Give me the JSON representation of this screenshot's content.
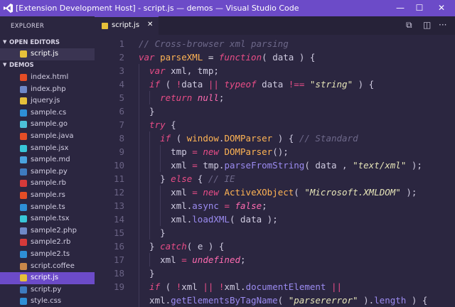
{
  "window": {
    "title": "[Extension Development Host] - script.js — demos — Visual Studio Code",
    "controls": {
      "minimize": "—",
      "maximize": "☐",
      "close": "✕"
    }
  },
  "sidebar": {
    "title": "EXPLORER",
    "open_editors_label": "OPEN EDITORS",
    "open_editors": [
      {
        "name": "script.js",
        "icon": "js-icon",
        "color": "#e6c03a"
      }
    ],
    "folder_label": "DEMOS",
    "files": [
      {
        "name": "index.html",
        "icon": "html5-icon",
        "color": "#e44d26",
        "glyph": "5"
      },
      {
        "name": "index.php",
        "icon": "php-icon",
        "color": "#6f89c8",
        "glyph": "php"
      },
      {
        "name": "jquery.js",
        "icon": "js-icon",
        "color": "#e6c03a",
        "glyph": "JS"
      },
      {
        "name": "sample.cs",
        "icon": "csharp-icon",
        "color": "#2e8fd6",
        "glyph": "C#"
      },
      {
        "name": "sample.go",
        "icon": "go-icon",
        "color": "#4cc0d9",
        "glyph": "go"
      },
      {
        "name": "sample.java",
        "icon": "java-icon",
        "color": "#e44d26",
        "glyph": "J"
      },
      {
        "name": "sample.jsx",
        "icon": "react-icon",
        "color": "#38c6d8",
        "glyph": "⚛"
      },
      {
        "name": "sample.md",
        "icon": "markdown-icon",
        "color": "#4aa3df",
        "glyph": "M"
      },
      {
        "name": "sample.py",
        "icon": "python-icon",
        "color": "#3e7bbf",
        "glyph": "py"
      },
      {
        "name": "sample.rb",
        "icon": "ruby-icon",
        "color": "#d63a3a",
        "glyph": "◆"
      },
      {
        "name": "sample.rs",
        "icon": "rust-icon",
        "color": "#e44d26",
        "glyph": "R"
      },
      {
        "name": "sample.ts",
        "icon": "typescript-icon",
        "color": "#2e8fd6",
        "glyph": "TS"
      },
      {
        "name": "sample.tsx",
        "icon": "react-icon",
        "color": "#38c6d8",
        "glyph": "⚛"
      },
      {
        "name": "sample2.php",
        "icon": "php-icon",
        "color": "#6f89c8",
        "glyph": "php"
      },
      {
        "name": "sample2.rb",
        "icon": "ruby-icon",
        "color": "#d63a3a",
        "glyph": "◆"
      },
      {
        "name": "sample2.ts",
        "icon": "typescript-icon",
        "color": "#2e8fd6",
        "glyph": "TS"
      },
      {
        "name": "script.coffee",
        "icon": "coffee-icon",
        "color": "#c9874a",
        "glyph": "☕"
      },
      {
        "name": "script.js",
        "icon": "js-icon",
        "color": "#e6c03a",
        "glyph": "JS",
        "selected": true
      },
      {
        "name": "script.py",
        "icon": "python-icon",
        "color": "#3e7bbf",
        "glyph": "py"
      },
      {
        "name": "style.css",
        "icon": "css3-icon",
        "color": "#2e8fd6",
        "glyph": "3"
      }
    ]
  },
  "editor": {
    "active_tab": "script.js",
    "close_glyph": "✕",
    "actions": {
      "split_glyph": "⧉",
      "layout_glyph": "◫",
      "more_glyph": "···"
    },
    "lines": [
      {
        "n": "1",
        "indent": 0,
        "tokens": [
          [
            "c",
            "// Cross-browser xml parsing"
          ]
        ]
      },
      {
        "n": "2",
        "indent": 0,
        "tokens": [
          [
            "k",
            "var "
          ],
          [
            "f",
            "parseXML"
          ],
          [
            "p",
            " = "
          ],
          [
            "k",
            "function"
          ],
          [
            "u",
            "( "
          ],
          [
            "v",
            "data"
          ],
          [
            "u",
            " ) {"
          ]
        ]
      },
      {
        "n": "3",
        "indent": 1,
        "tokens": [
          [
            "k",
            "var "
          ],
          [
            "v",
            "xml, tmp;"
          ]
        ]
      },
      {
        "n": "4",
        "indent": 1,
        "tokens": [
          [
            "k",
            "if"
          ],
          [
            "u",
            " ( "
          ],
          [
            "o",
            "!"
          ],
          [
            "v",
            "data "
          ],
          [
            "o",
            "||"
          ],
          [
            "k",
            " typeof "
          ],
          [
            "v",
            "data "
          ],
          [
            "o",
            "!=="
          ],
          [
            "u",
            " "
          ],
          [
            "s",
            "\"string\""
          ],
          [
            "u",
            " ) {"
          ]
        ]
      },
      {
        "n": "5",
        "indent": 2,
        "tokens": [
          [
            "k",
            "return "
          ],
          [
            "b",
            "null"
          ],
          [
            "u",
            ";"
          ]
        ]
      },
      {
        "n": "6",
        "indent": 1,
        "tokens": [
          [
            "u",
            "}"
          ]
        ]
      },
      {
        "n": "7",
        "indent": 1,
        "tokens": [
          [
            "k",
            "try"
          ],
          [
            "u",
            " {"
          ]
        ]
      },
      {
        "n": "8",
        "indent": 2,
        "tokens": [
          [
            "k",
            "if"
          ],
          [
            "u",
            " ( "
          ],
          [
            "i",
            "window"
          ],
          [
            "u",
            "."
          ],
          [
            "i",
            "DOMParser"
          ],
          [
            "u",
            " ) { "
          ],
          [
            "c",
            "// Standard"
          ]
        ]
      },
      {
        "n": "9",
        "indent": 3,
        "tokens": [
          [
            "v",
            "tmp "
          ],
          [
            "o",
            "="
          ],
          [
            "k",
            " new "
          ],
          [
            "i",
            "DOMParser"
          ],
          [
            "u",
            "();"
          ]
        ]
      },
      {
        "n": "10",
        "indent": 3,
        "tokens": [
          [
            "v",
            "xml "
          ],
          [
            "o",
            "="
          ],
          [
            "v",
            " tmp."
          ],
          [
            "r",
            "parseFromString"
          ],
          [
            "u",
            "( "
          ],
          [
            "v",
            "data"
          ],
          [
            "u",
            " , "
          ],
          [
            "s",
            "\"text/xml\""
          ],
          [
            "u",
            " );"
          ]
        ]
      },
      {
        "n": "11",
        "indent": 2,
        "tokens": [
          [
            "u",
            "} "
          ],
          [
            "k",
            "else"
          ],
          [
            "u",
            " { "
          ],
          [
            "c",
            "// IE"
          ]
        ]
      },
      {
        "n": "12",
        "indent": 3,
        "tokens": [
          [
            "v",
            "xml "
          ],
          [
            "o",
            "="
          ],
          [
            "k",
            " new "
          ],
          [
            "i",
            "ActiveXObject"
          ],
          [
            "u",
            "( "
          ],
          [
            "s",
            "\"Microsoft.XMLDOM\""
          ],
          [
            "u",
            " );"
          ]
        ]
      },
      {
        "n": "13",
        "indent": 3,
        "tokens": [
          [
            "v",
            "xml."
          ],
          [
            "r",
            "async"
          ],
          [
            "o",
            " = "
          ],
          [
            "b",
            "false"
          ],
          [
            "u",
            ";"
          ]
        ]
      },
      {
        "n": "14",
        "indent": 3,
        "tokens": [
          [
            "v",
            "xml."
          ],
          [
            "r",
            "loadXML"
          ],
          [
            "u",
            "( "
          ],
          [
            "v",
            "data"
          ],
          [
            "u",
            " );"
          ]
        ]
      },
      {
        "n": "15",
        "indent": 2,
        "tokens": [
          [
            "u",
            "}"
          ]
        ]
      },
      {
        "n": "16",
        "indent": 1,
        "tokens": [
          [
            "u",
            "} "
          ],
          [
            "k",
            "catch"
          ],
          [
            "u",
            "( "
          ],
          [
            "v",
            "e"
          ],
          [
            "u",
            " ) {"
          ]
        ]
      },
      {
        "n": "17",
        "indent": 2,
        "tokens": [
          [
            "v",
            "xml "
          ],
          [
            "o",
            "="
          ],
          [
            "b",
            " undefined"
          ],
          [
            "u",
            ";"
          ]
        ]
      },
      {
        "n": "18",
        "indent": 1,
        "tokens": [
          [
            "u",
            "}"
          ]
        ]
      },
      {
        "n": "19",
        "indent": 1,
        "tokens": [
          [
            "k",
            "if"
          ],
          [
            "u",
            " ( "
          ],
          [
            "o",
            "!"
          ],
          [
            "v",
            "xml "
          ],
          [
            "o",
            "||"
          ],
          [
            "o",
            " !"
          ],
          [
            "v",
            "xml."
          ],
          [
            "r",
            "documentElement"
          ],
          [
            "o",
            " ||"
          ]
        ]
      },
      {
        "n": "",
        "indent": 1,
        "tokens": [
          [
            "v",
            "xml."
          ],
          [
            "r",
            "getElementsByTagName"
          ],
          [
            "u",
            "( "
          ],
          [
            "s",
            "\"parsererror\""
          ],
          [
            "u",
            " )."
          ],
          [
            "r",
            "length"
          ],
          [
            "u",
            " ) {"
          ]
        ]
      }
    ]
  },
  "colors": {
    "titlebar": "#6c4bc8",
    "background": "#2b2640",
    "selection": "#6c4bc8",
    "comment": "#6d6889",
    "keyword": "#e94d87",
    "function": "#ffb454",
    "string": "#e6e4b8",
    "property": "#9b8bf0"
  }
}
